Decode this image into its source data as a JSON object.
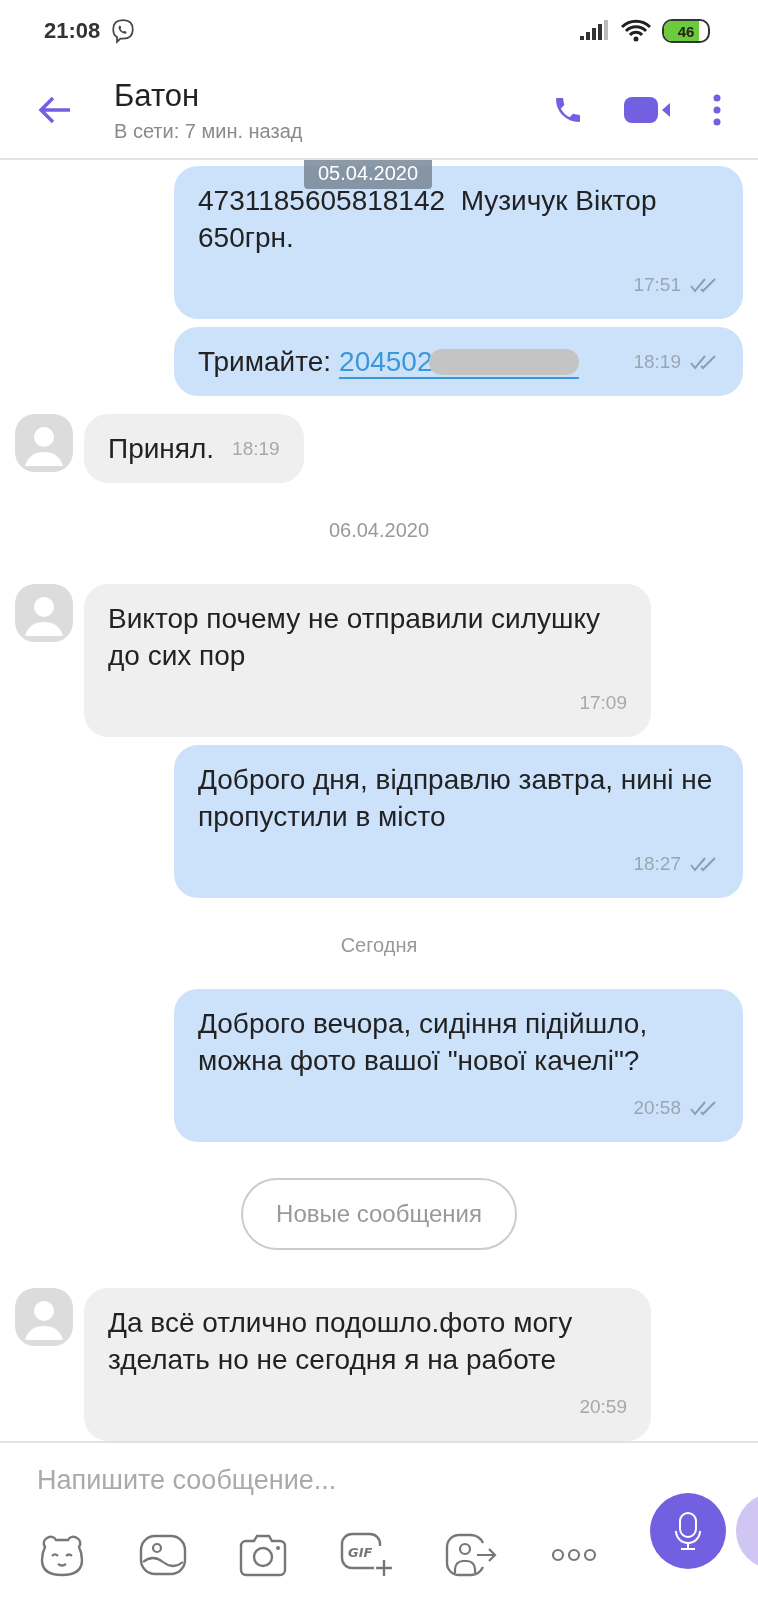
{
  "status_bar": {
    "time": "21:08",
    "battery": "46"
  },
  "header": {
    "title": "Батон",
    "subtitle": "В сети: 7 мин. назад"
  },
  "sticky_date": "05.04.2020",
  "messages": [
    {
      "kind": "outgoing",
      "text": "4731185605818142  Музичук Віктор 650грн.",
      "time": "17:51"
    },
    {
      "kind": "outgoing",
      "text": "Тримайте:",
      "link": "204502",
      "redacted": true,
      "time": "18:19"
    },
    {
      "kind": "incoming",
      "text": "Принял.",
      "time": "18:19"
    },
    {
      "kind": "date",
      "text": "06.04.2020"
    },
    {
      "kind": "incoming",
      "text": "Виктор почему не отправили силушку до сих пор",
      "time": "17:09"
    },
    {
      "kind": "outgoing",
      "text": "Доброго дня, відправлю завтра, нині не пропустили в місто",
      "time": "18:27"
    },
    {
      "kind": "date",
      "text": "Сегодня"
    },
    {
      "kind": "outgoing",
      "text": "Доброго вечора, сидіння підійшло, можна фото вашої \"нової качелі\"?",
      "time": "20:58"
    },
    {
      "kind": "new",
      "text": "Новые сообщения"
    },
    {
      "kind": "incoming",
      "text": "Да всё отлично подошло.фото могу зделать но не сегодня я на работе",
      "time": "20:59"
    }
  ],
  "composer": {
    "placeholder": "Напишите сообщение...",
    "gif_label": "GIF"
  }
}
